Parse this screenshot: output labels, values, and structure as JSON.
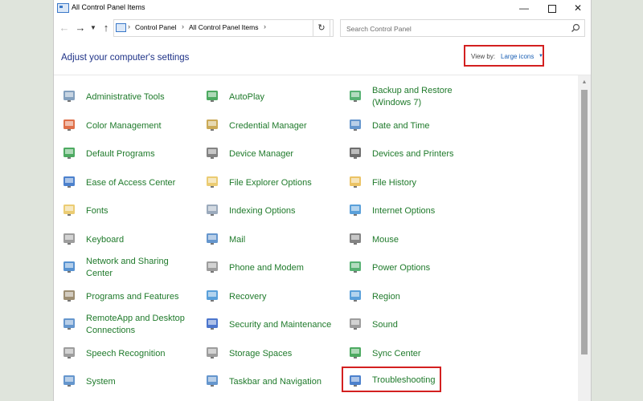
{
  "window": {
    "title": "All Control Panel Items"
  },
  "navigation": {
    "breadcrumbs": [
      "Control Panel",
      "All Control Panel Items"
    ],
    "search_placeholder": "Search Control Panel"
  },
  "header": {
    "title": "Adjust your computer's settings",
    "view_by_label": "View by:",
    "view_by_value": "Large icons"
  },
  "items": [
    {
      "label": "Administrative Tools",
      "icon": "administrative-tools-icon",
      "color": "#6d8fb3"
    },
    {
      "label": "AutoPlay",
      "icon": "autoplay-icon",
      "color": "#2e9b45"
    },
    {
      "label": "Backup and Restore\n(Windows 7)",
      "icon": "backup-restore-icon",
      "color": "#3ba55c"
    },
    {
      "label": "Color Management",
      "icon": "color-management-icon",
      "color": "#d9572a"
    },
    {
      "label": "Credential Manager",
      "icon": "credential-manager-icon",
      "color": "#c29b3a"
    },
    {
      "label": "Date and Time",
      "icon": "date-time-icon",
      "color": "#4a84c4"
    },
    {
      "label": "Default Programs",
      "icon": "default-programs-icon",
      "color": "#2e9b45"
    },
    {
      "label": "Device Manager",
      "icon": "device-manager-icon",
      "color": "#6d6d6d"
    },
    {
      "label": "Devices and Printers",
      "icon": "devices-printers-icon",
      "color": "#555555"
    },
    {
      "label": "Ease of Access Center",
      "icon": "ease-of-access-icon",
      "color": "#2d6bc4"
    },
    {
      "label": "File Explorer Options",
      "icon": "file-explorer-options-icon",
      "color": "#e8c35a"
    },
    {
      "label": "File History",
      "icon": "file-history-icon",
      "color": "#e8b84a"
    },
    {
      "label": "Fonts",
      "icon": "fonts-icon",
      "color": "#e8c35a"
    },
    {
      "label": "Indexing Options",
      "icon": "indexing-options-icon",
      "color": "#8a9bb0"
    },
    {
      "label": "Internet Options",
      "icon": "internet-options-icon",
      "color": "#3d8fd4"
    },
    {
      "label": "Keyboard",
      "icon": "keyboard-icon",
      "color": "#8c8c8c"
    },
    {
      "label": "Mail",
      "icon": "mail-icon",
      "color": "#4a84c4"
    },
    {
      "label": "Mouse",
      "icon": "mouse-icon",
      "color": "#6d6d6d"
    },
    {
      "label": "Network and Sharing\nCenter",
      "icon": "network-sharing-icon",
      "color": "#3a7fc9"
    },
    {
      "label": "Phone and Modem",
      "icon": "phone-modem-icon",
      "color": "#8c8c8c"
    },
    {
      "label": "Power Options",
      "icon": "power-options-icon",
      "color": "#3ba55c"
    },
    {
      "label": "Programs and Features",
      "icon": "programs-features-icon",
      "color": "#8c7a5a"
    },
    {
      "label": "Recovery",
      "icon": "recovery-icon",
      "color": "#3d8fd4"
    },
    {
      "label": "Region",
      "icon": "region-icon",
      "color": "#3d8fd4"
    },
    {
      "label": "RemoteApp and Desktop\nConnections",
      "icon": "remoteapp-icon",
      "color": "#4a84c4"
    },
    {
      "label": "Security and Maintenance",
      "icon": "security-maintenance-icon",
      "color": "#2d5ec4"
    },
    {
      "label": "Sound",
      "icon": "sound-icon",
      "color": "#8c8c8c"
    },
    {
      "label": "Speech Recognition",
      "icon": "speech-recognition-icon",
      "color": "#8c8c8c"
    },
    {
      "label": "Storage Spaces",
      "icon": "storage-spaces-icon",
      "color": "#8c8c8c"
    },
    {
      "label": "Sync Center",
      "icon": "sync-center-icon",
      "color": "#2e9b45"
    },
    {
      "label": "System",
      "icon": "system-icon",
      "color": "#4a84c4"
    },
    {
      "label": "Taskbar and Navigation",
      "icon": "taskbar-navigation-icon",
      "color": "#4a84c4"
    },
    {
      "label": "Troubleshooting",
      "icon": "troubleshooting-icon",
      "color": "#2d6bc4",
      "highlighted": true
    }
  ]
}
